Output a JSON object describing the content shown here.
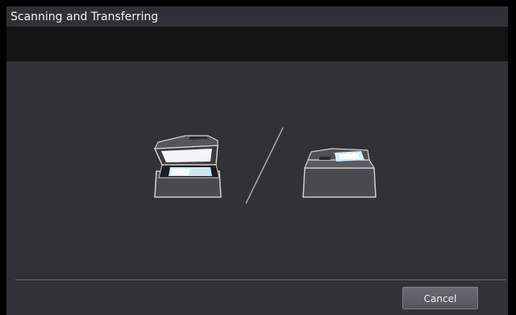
{
  "window": {
    "title": "Scanning and Transferring"
  },
  "icons": [
    "flatbed-scanner-icon",
    "document-feeder-scanner-icon"
  ],
  "footer": {
    "cancel_label": "Cancel"
  }
}
